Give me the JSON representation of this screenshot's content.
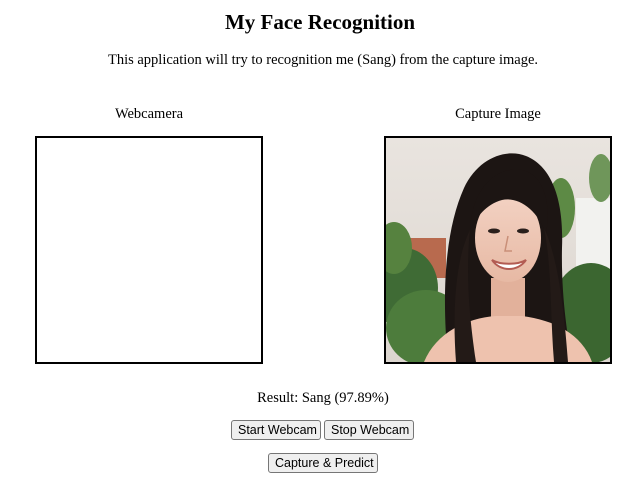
{
  "page": {
    "title": "My Face Recognition",
    "description": "This application will try to recognition me (Sang) from the capture image."
  },
  "webcam": {
    "label": "Webcamera"
  },
  "capture": {
    "label": "Capture Image"
  },
  "result": {
    "text": "Result: Sang (97.89%)"
  },
  "buttons": {
    "start_webcam": "Start Webcam",
    "stop_webcam": "Stop Webcam",
    "capture_predict": "Capture & Predict"
  }
}
